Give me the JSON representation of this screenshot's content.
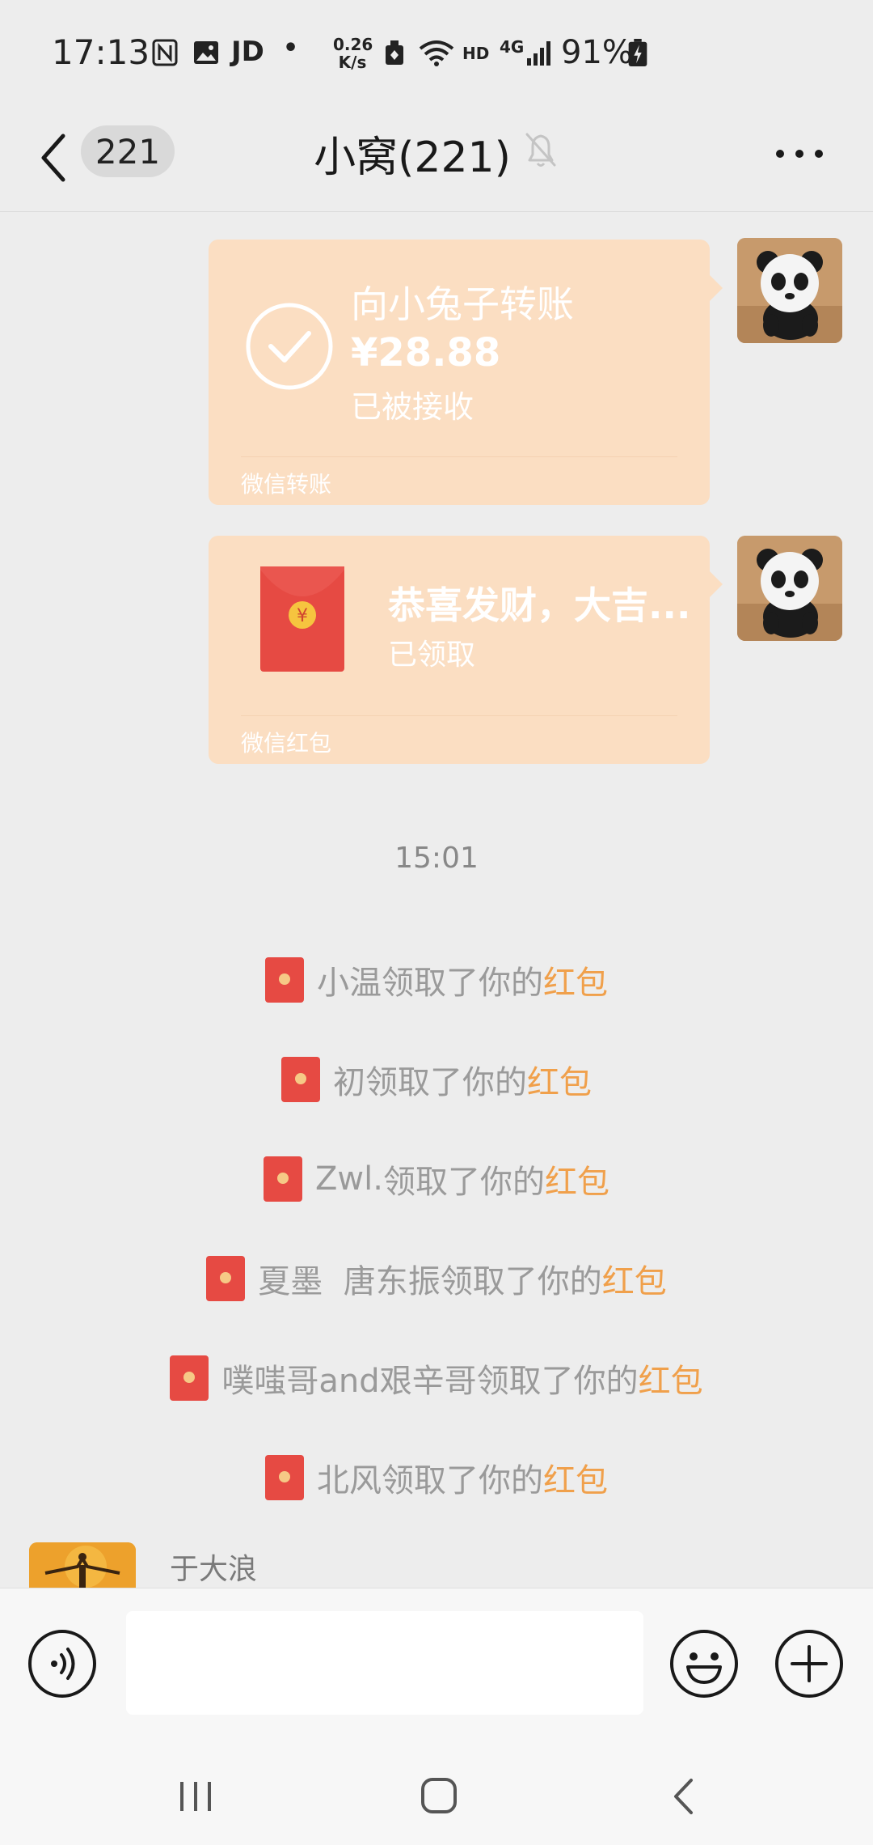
{
  "status_bar": {
    "time": "17:13",
    "app_label": "JD",
    "net_speed_value": "0.26",
    "net_speed_unit": "K/s",
    "hd_label": "HD",
    "network_label": "4G",
    "battery": "91%"
  },
  "header": {
    "unread_count": "221",
    "title": "小窝(221)"
  },
  "messages": {
    "transfer": {
      "title": "向小兔子转账",
      "amount": "¥28.88",
      "status": "已被接收",
      "footer": "微信转账"
    },
    "red_packet": {
      "greeting": "恭喜发财，大吉...",
      "status": "已领取",
      "footer": "微信红包",
      "coin_symbol": "¥"
    }
  },
  "timestamp": "15:01",
  "system_messages": [
    {
      "name": "小温",
      "suffix": "领取了你的",
      "link": "红包"
    },
    {
      "name": "初",
      "suffix": "领取了你的",
      "link": "红包"
    },
    {
      "name": "Zwl.",
      "suffix": "领取了你的",
      "link": "红包"
    },
    {
      "name": "夏墨  唐东振",
      "suffix": "领取了你的",
      "link": "红包"
    },
    {
      "name": "噗嗤哥and艰辛哥",
      "suffix": "领取了你的",
      "link": "红包"
    },
    {
      "name": "北风",
      "suffix": "领取了你的",
      "link": "红包"
    }
  ],
  "next_sender": {
    "name": "于大浪"
  },
  "colors": {
    "bubble": "#fbdec2",
    "red_packet": "#e64a43",
    "link": "#f0a04b",
    "background": "#ededed"
  },
  "icons": {
    "back": "chevron-left-icon",
    "mute": "bell-off-icon",
    "more": "more-dots-icon",
    "transfer": "check-circle-icon",
    "voice": "voice-icon",
    "emoji": "emoji-icon",
    "plus": "plus-circle-icon"
  }
}
